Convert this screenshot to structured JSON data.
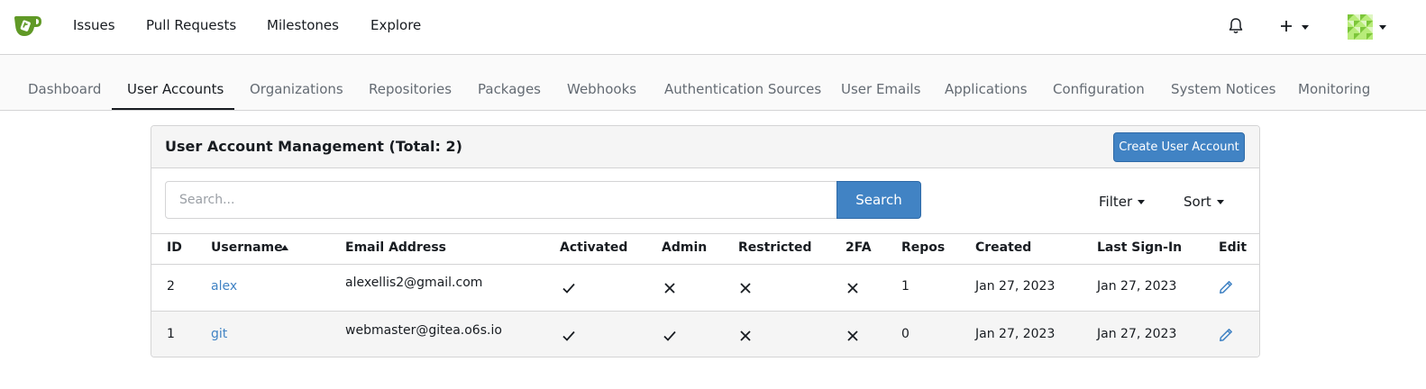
{
  "topnav": {
    "items": [
      "Issues",
      "Pull Requests",
      "Milestones",
      "Explore"
    ],
    "icons": [
      "logo-icon",
      "bell-icon",
      "plus-icon",
      "avatar"
    ]
  },
  "tabs": [
    "Dashboard",
    "User Accounts",
    "Organizations",
    "Repositories",
    "Packages",
    "Webhooks",
    "Authentication Sources",
    "User Emails",
    "Applications",
    "Configuration",
    "System Notices",
    "Monitoring"
  ],
  "active_tab": "User Accounts",
  "panel": {
    "title": "User Account Management (Total: 2)",
    "create_label": "Create User Account",
    "search_placeholder": "Search...",
    "search_label": "Search",
    "filter_label": "Filter",
    "sort_label": "Sort"
  },
  "table": {
    "headers": [
      "ID",
      "Username",
      "Email Address",
      "Activated",
      "Admin",
      "Restricted",
      "2FA",
      "Repos",
      "Created",
      "Last Sign-In",
      "Edit"
    ],
    "rows": [
      {
        "id": "2",
        "username": "alex",
        "email": "alexellis2@gmail.com",
        "activated": true,
        "admin": false,
        "restricted": false,
        "twofa": false,
        "repos": "1",
        "created": "Jan 27, 2023",
        "last_signin": "Jan 27, 2023"
      },
      {
        "id": "1",
        "username": "git",
        "email": "webmaster@gitea.o6s.io",
        "activated": true,
        "admin": true,
        "restricted": false,
        "twofa": false,
        "repos": "0",
        "created": "Jan 27, 2023",
        "last_signin": "Jan 27, 2023"
      }
    ]
  },
  "colors": {
    "accent": "#4183c4",
    "brand_green": "#609926"
  }
}
